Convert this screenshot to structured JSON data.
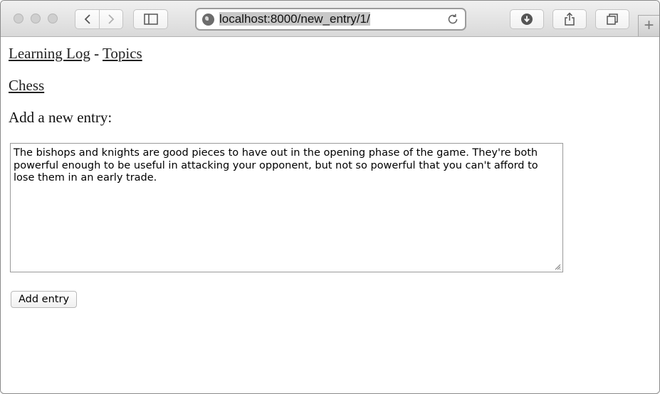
{
  "browser": {
    "url_text": "localhost:8000/new_entry/1/",
    "new_tab_label": "+"
  },
  "page": {
    "nav": {
      "home_link": "Learning Log",
      "separator": " - ",
      "topics_link": "Topics"
    },
    "topic_link": "Chess",
    "heading": "Add a new entry:",
    "entry_text": "The bishops and knights are good pieces to have out in the opening phase of the game. They're both powerful enough to be useful in attacking your opponent, but not so powerful that you can't afford to lose them in an early trade.",
    "submit_label": "Add entry"
  }
}
